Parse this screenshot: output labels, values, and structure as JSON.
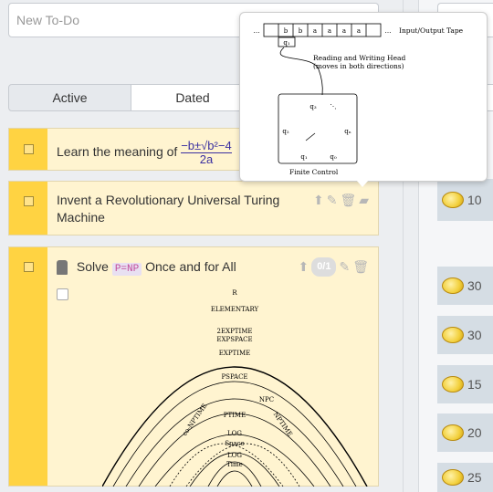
{
  "new_todo": {
    "placeholder": "New To-Do"
  },
  "tabs": [
    {
      "label": "Active"
    },
    {
      "label": "Dated"
    }
  ],
  "tasks": [
    {
      "text": "Learn the meaning of",
      "formula_num": "−b±√b²−4",
      "formula_den": "2a"
    },
    {
      "text": "Invent a Revolutionary Universal Turing Machine"
    },
    {
      "prefix": "Solve",
      "tag": "P=NP",
      "suffix": "Once and for All",
      "checklist": "0/1"
    }
  ],
  "popover": {
    "tape_label": "Input/Output Tape",
    "tape_cells": [
      "…",
      "b",
      "b",
      "a",
      "a",
      "a",
      "a",
      "…"
    ],
    "head_label": "q₁",
    "head_desc_1": "Reading and Writing Head",
    "head_desc_2": "(moves in both directions)",
    "states": [
      "q₃",
      "⋱",
      "q₂",
      "qₙ",
      "q₁",
      "q₀"
    ],
    "control_label": "Finite Control"
  },
  "diagram": {
    "labels": [
      "R",
      "ELEMENTARY",
      "2EXPTIME",
      "EXPSPACE",
      "EXPTIME",
      "PSPACE",
      "NPC",
      "co-NPTIME",
      "PTIME",
      "NPTIME",
      "LOG",
      "Space",
      "LOG",
      "Time"
    ]
  },
  "rewards": [
    {
      "value": "10"
    },
    {
      "value": "30"
    },
    {
      "value": "30"
    },
    {
      "value": "15"
    },
    {
      "value": "20"
    },
    {
      "value": "25"
    }
  ]
}
